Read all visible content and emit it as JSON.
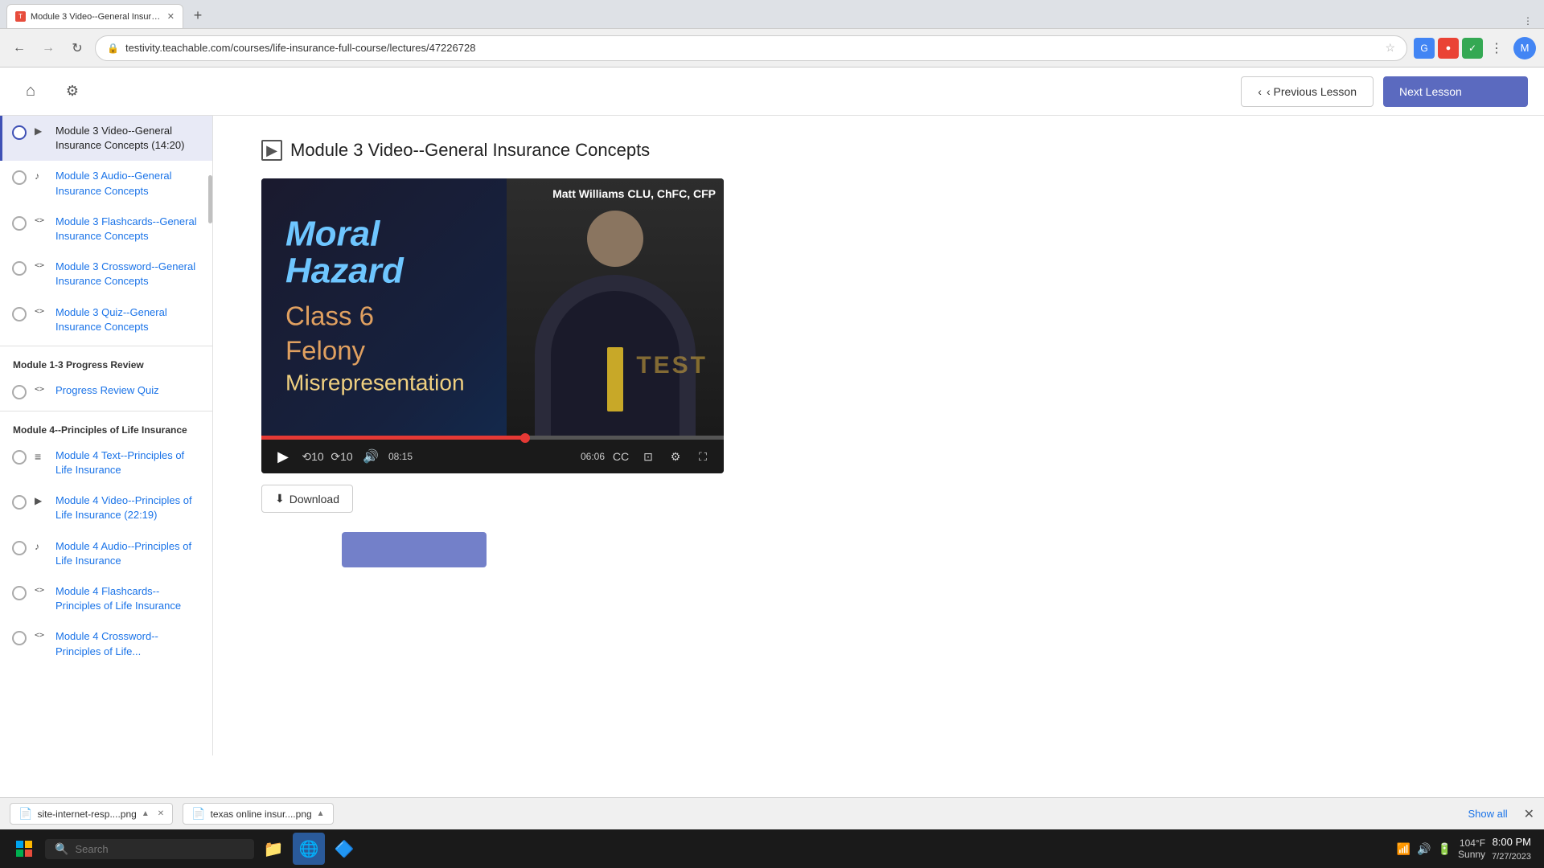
{
  "browser": {
    "url": "testivity.teachable.com/courses/life-insurance-full-course/lectures/47226728",
    "tab_label": "Module 3 Video--General Insurance...",
    "back_btn": "←",
    "forward_btn": "→",
    "refresh_btn": "↻"
  },
  "app_header": {
    "home_label": "🏠",
    "settings_label": "⚙",
    "prev_lesson_label": "‹ Previous Lesson",
    "next_lesson_label": "Next Lesson"
  },
  "sidebar": {
    "sections": [
      {
        "items": [
          {
            "id": "m3-video",
            "icon": "▶",
            "title": "Module 3 Video--General Insurance Concepts (14:20)",
            "active": true
          },
          {
            "id": "m3-audio",
            "icon": "♪",
            "title": "Module 3 Audio--General Insurance Concepts",
            "active": false
          },
          {
            "id": "m3-flash",
            "icon": "<>",
            "title": "Module 3 Flashcards--General Insurance Concepts",
            "active": false
          },
          {
            "id": "m3-cross",
            "icon": "<>",
            "title": "Module 3 Crossword--General Insurance Concepts",
            "active": false
          },
          {
            "id": "m3-quiz",
            "icon": "<>",
            "title": "Module 3 Quiz--General Insurance Concepts",
            "active": false
          }
        ]
      },
      {
        "header": "Module 1-3 Progress Review",
        "items": [
          {
            "id": "progress-quiz",
            "icon": "<>",
            "title": "Progress Review Quiz",
            "active": false
          }
        ]
      },
      {
        "header": "Module 4--Principles of Life Insurance",
        "items": [
          {
            "id": "m4-text",
            "icon": "≡",
            "title": "Module 4 Text--Principles of Life Insurance",
            "active": false
          },
          {
            "id": "m4-video",
            "icon": "▶",
            "title": "Module 4 Video--Principles of Life Insurance (22:19)",
            "active": false
          },
          {
            "id": "m4-audio",
            "icon": "♪",
            "title": "Module 4 Audio--Principles of Life Insurance",
            "active": false
          },
          {
            "id": "m4-flash",
            "icon": "<>",
            "title": "Module 4 Flashcards--Principles of Life Insurance",
            "active": false
          },
          {
            "id": "m4-cross",
            "icon": "<>",
            "title": "Module 4 Crossword--Principles of Life...",
            "active": false
          }
        ]
      }
    ]
  },
  "main": {
    "lesson_title": "Module 3 Video--General Insurance Concepts",
    "video": {
      "presenter_name": "Matt Williams CLU, ChFC, CFP",
      "overlay_line1": "Moral",
      "overlay_line2": "Hazard",
      "overlay_line3": "Class 6",
      "overlay_line4": "Felony",
      "overlay_line5": "Misrepresentation",
      "watermark": "TEST",
      "time_elapsed": "08:15",
      "time_remaining": "06:06",
      "progress_pct": 57
    },
    "download_label": "Download"
  },
  "taskbar": {
    "search_placeholder": "Search",
    "time": "8:00 PM",
    "date": "7/27/2023",
    "temperature": "104°F",
    "condition": "Sunny"
  },
  "file_bar": {
    "files": [
      {
        "name": "site-internet-resp....png",
        "icon": "📄"
      },
      {
        "name": "texas online insur....png",
        "icon": "📄"
      }
    ],
    "show_all": "Show all",
    "close": "✕"
  }
}
